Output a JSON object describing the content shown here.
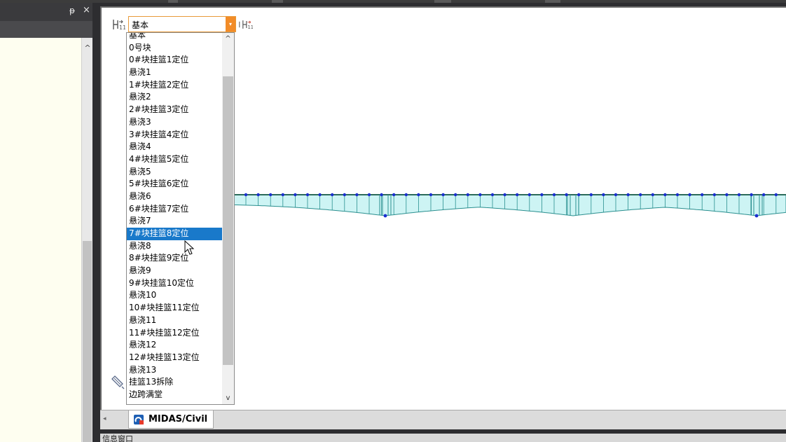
{
  "left_panel": {
    "pin_glyph": "ᵽ",
    "close_glyph": "×",
    "scroll_up_glyph": "^"
  },
  "toolbar": {
    "stage_combo_value": "基本",
    "combo_arrow_glyph": "▾",
    "prev_stage_icon": "stage-prev-icon",
    "next_stage_icon": "stage-next-icon"
  },
  "dropdown": {
    "items": [
      "基本",
      "0号块",
      "0#块挂篮1定位",
      "悬浇1",
      "1#块挂篮2定位",
      "悬浇2",
      "2#块挂篮3定位",
      "悬浇3",
      "3#块挂篮4定位",
      "悬浇4",
      "4#块挂篮5定位",
      "悬浇5",
      "5#块挂篮6定位",
      "悬浇6",
      "6#块挂篮7定位",
      "悬浇7",
      "7#块挂篮8定位",
      "悬浇8",
      "8#块挂篮9定位",
      "悬浇9",
      "9#块挂篮10定位",
      "悬浇10",
      "10#块挂篮11定位",
      "悬浇11",
      "11#块挂篮12定位",
      "悬浇12",
      "12#块挂篮13定位",
      "悬浇13",
      "挂篮13拆除",
      "边跨满堂"
    ],
    "selected_index": 16,
    "scroll_up_glyph": "^",
    "scroll_down_glyph": "v"
  },
  "tabs": [
    {
      "label": "MIDAS/Civil",
      "icon": "midas-civil-icon"
    }
  ],
  "tab_scroll_glyph": "◂",
  "bottom_window": {
    "title": "信息窗口"
  },
  "colors": {
    "selection": "#1979ca",
    "combo_accent": "#f28c28",
    "bridge_fill": "#cdf4f4",
    "bridge_line": "#2a8f8f",
    "node": "#1a2fd0"
  }
}
